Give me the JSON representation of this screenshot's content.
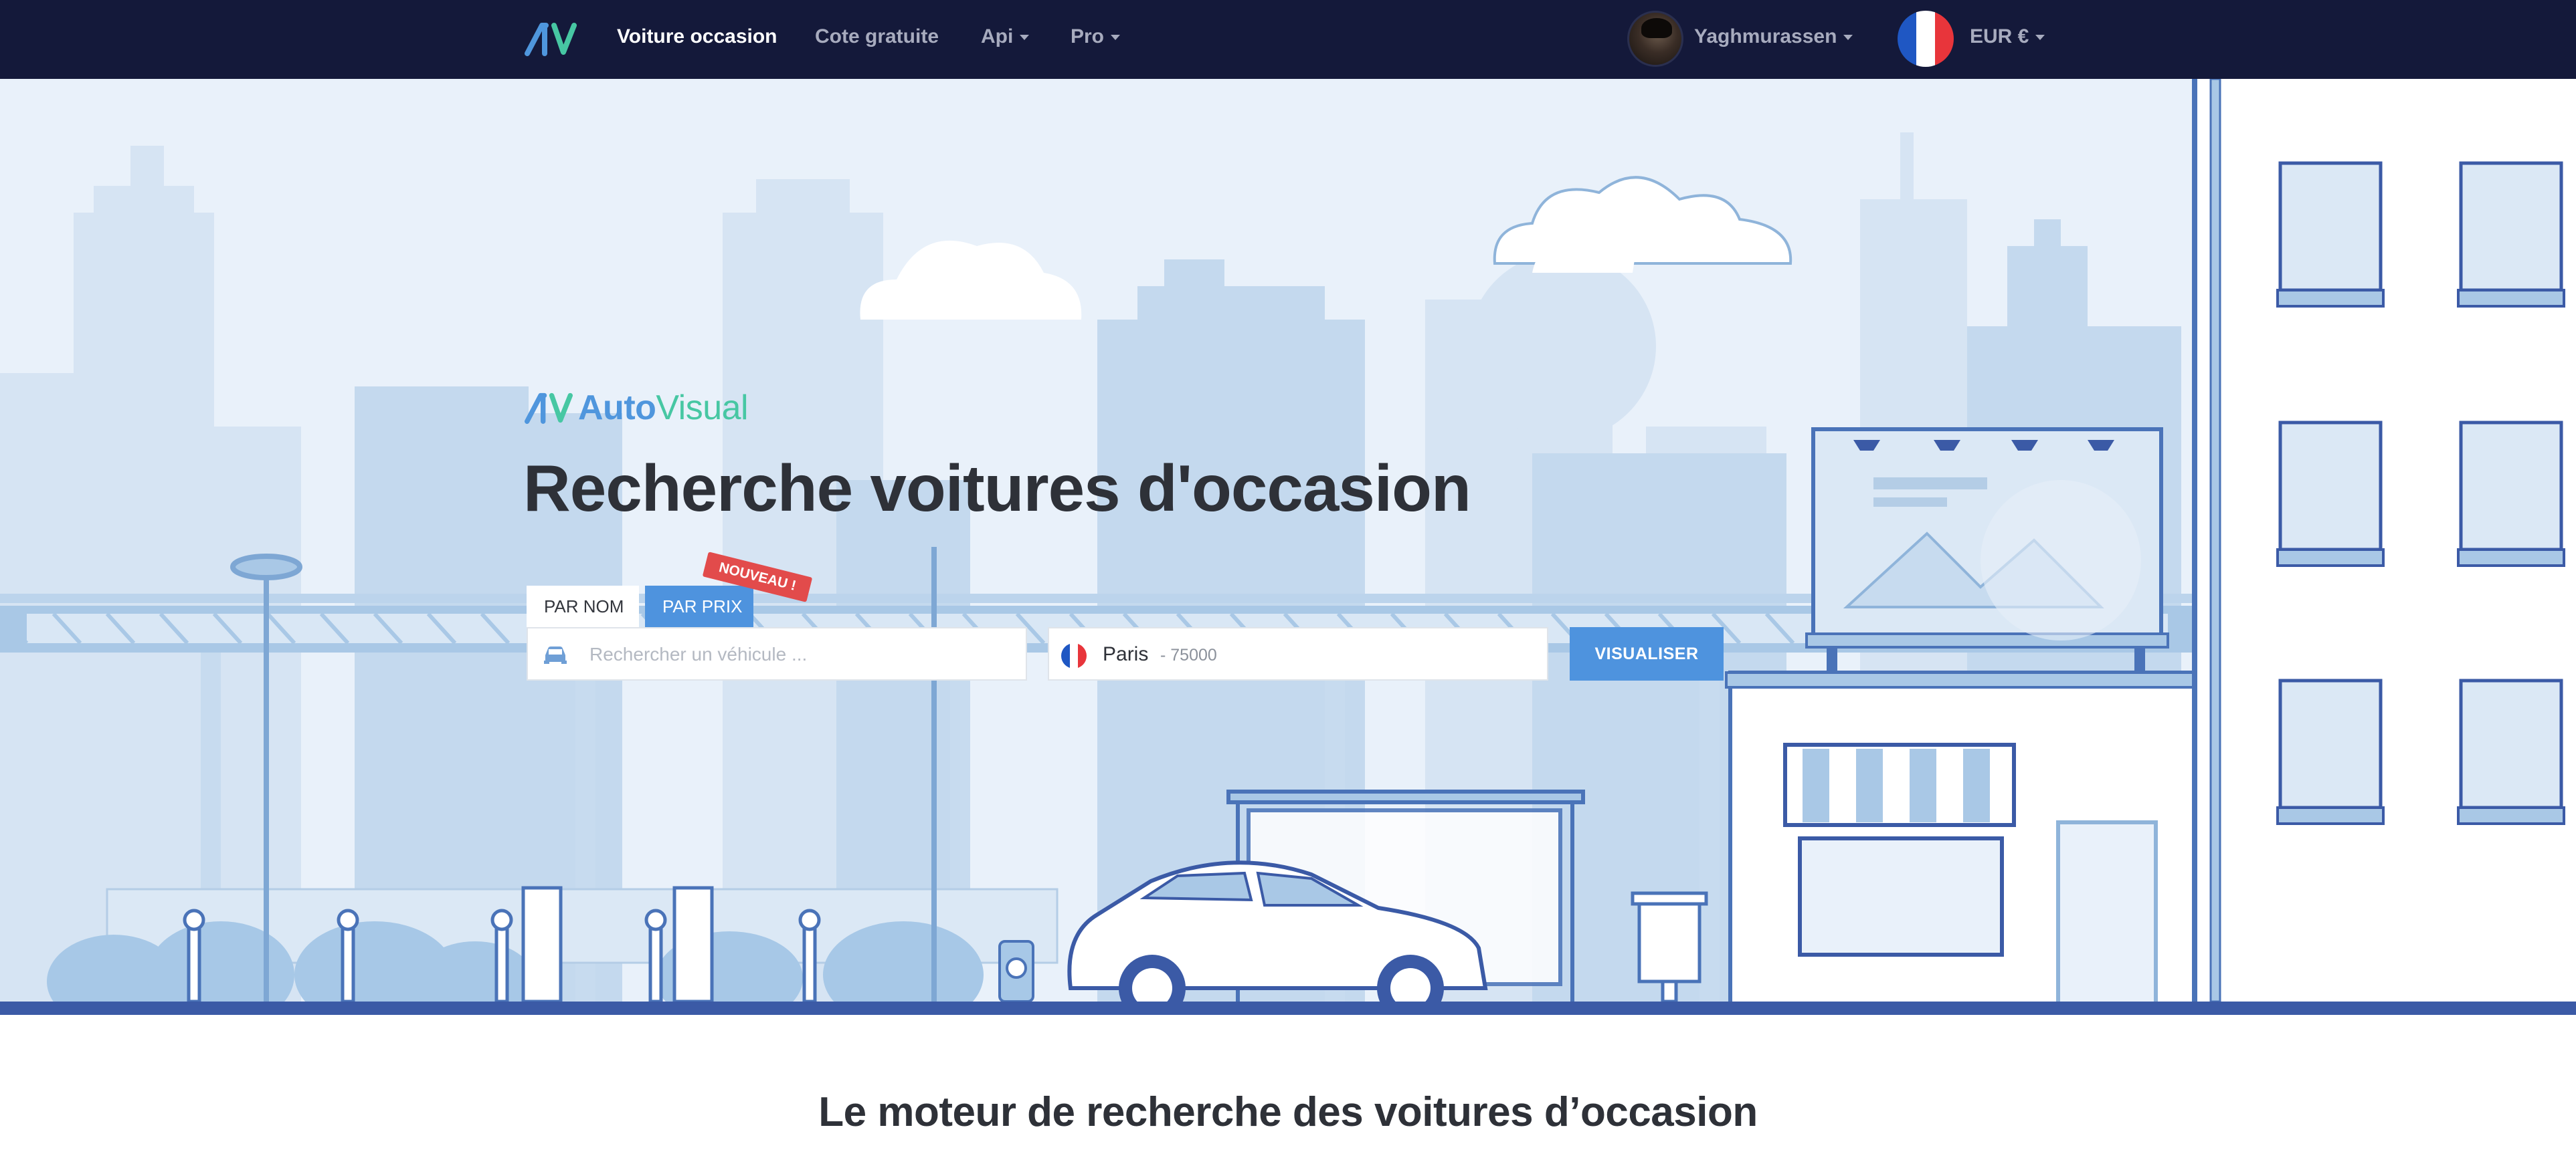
{
  "nav": {
    "links": [
      {
        "label": "Voiture occasion",
        "active": true
      },
      {
        "label": "Cote gratuite"
      },
      {
        "label": "Api",
        "dropdown": true
      },
      {
        "label": "Pro",
        "dropdown": true
      }
    ],
    "user_name": "Yaghmurassen",
    "currency": "EUR €"
  },
  "hero": {
    "brand_part1": "Auto",
    "brand_part2": "Visual",
    "title": "Recherche voitures d'occasion",
    "tabs": [
      {
        "label": "Par nom",
        "active": true
      },
      {
        "label": "Par prix",
        "active": false
      }
    ],
    "badge_new": "NOUVEAU !",
    "search_placeholder": "Rechercher un véhicule ...",
    "location_city": "Paris",
    "location_zip": "- 75000",
    "submit_label": "Visualiser"
  },
  "colors": {
    "navbar": "#14193a",
    "accent": "#4e93de",
    "brand_green": "#47c7a3",
    "badge": "#e24b4b",
    "hero_bg": "#e9f1fa"
  },
  "icons": [
    "logo-icon",
    "caret-down-icon",
    "car-icon",
    "flag-fr-icon"
  ],
  "section": {
    "tagline": "Le moteur de recherche des voitures d’occasion"
  }
}
